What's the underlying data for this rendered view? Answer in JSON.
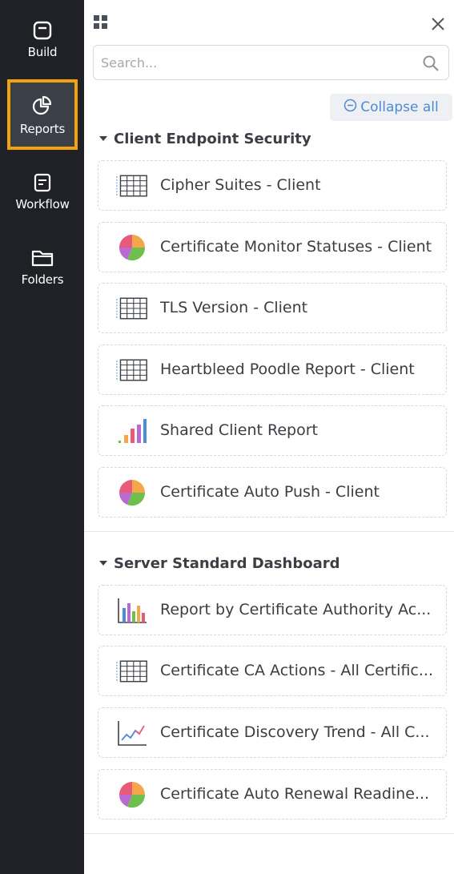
{
  "nav": {
    "items": [
      {
        "label": "Build",
        "icon": "build-icon"
      },
      {
        "label": "Reports",
        "icon": "reports-icon",
        "active": true
      },
      {
        "label": "Workflow",
        "icon": "workflow-icon"
      },
      {
        "label": "Folders",
        "icon": "folders-icon"
      }
    ]
  },
  "search": {
    "placeholder": "Search..."
  },
  "collapse_all": {
    "label": "Collapse all"
  },
  "groups": [
    {
      "title": "Client Endpoint Security",
      "items": [
        {
          "label": "Cipher Suites - Client",
          "icon": "table-icon"
        },
        {
          "label": "Certificate Monitor Statuses - Client",
          "icon": "pie-chart-icon"
        },
        {
          "label": "TLS Version - Client",
          "icon": "table-icon"
        },
        {
          "label": "Heartbleed Poodle Report - Client",
          "icon": "table-icon"
        },
        {
          "label": "Shared Client Report",
          "icon": "bar-chart-icon"
        },
        {
          "label": "Certificate Auto Push - Client",
          "icon": "pie-chart-icon"
        }
      ]
    },
    {
      "title": "Server Standard Dashboard",
      "items": [
        {
          "label": "Report by Certificate Authority Ac...",
          "icon": "column-chart-icon"
        },
        {
          "label": "Certificate CA Actions - All Certific...",
          "icon": "table-icon"
        },
        {
          "label": "Certificate Discovery Trend - All C...",
          "icon": "line-chart-icon"
        },
        {
          "label": "Certificate Auto Renewal Readine...",
          "icon": "pie-chart-icon"
        }
      ]
    }
  ],
  "colors": {
    "rail_bg": "#1f2126",
    "active_border": "#f2a20c",
    "accent": "#4c8bd6"
  }
}
